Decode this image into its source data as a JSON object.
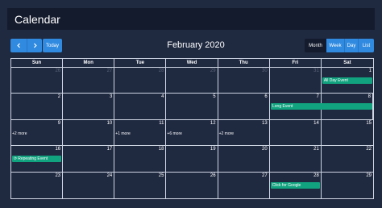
{
  "app": {
    "title": "Calendar"
  },
  "toolbar": {
    "today_label": "Today",
    "month_title": "February 2020",
    "views": [
      "Month",
      "Week",
      "Day",
      "List"
    ]
  },
  "weekdays": [
    "Sun",
    "Mon",
    "Tue",
    "Wed",
    "Thu",
    "Fri",
    "Sat"
  ],
  "weeks": [
    [
      "26",
      "27",
      "28",
      "29",
      "30",
      "31",
      "1"
    ],
    [
      "2",
      "3",
      "4",
      "5",
      "6",
      "7",
      "8"
    ],
    [
      "9",
      "10",
      "11",
      "12",
      "13",
      "14",
      "15"
    ],
    [
      "16",
      "17",
      "18",
      "19",
      "20",
      "21",
      "22"
    ],
    [
      "23",
      "24",
      "25",
      "26",
      "27",
      "28",
      "29"
    ]
  ],
  "more_links": {
    "week2_sun": "+2 more",
    "week2_tue": "+1 more",
    "week2_wed": "+6 more",
    "week2_fri": "+2 more"
  },
  "events": {
    "all_day": "All Day Event",
    "long": "Long Event",
    "repeating": "Repeating Event",
    "google": "Click for Google"
  },
  "colors": {
    "background": "#1f2940",
    "titlebar": "#141b2d",
    "accent": "#2f8ae0",
    "event": "#11a37f",
    "grid": "#cfd6e4"
  }
}
